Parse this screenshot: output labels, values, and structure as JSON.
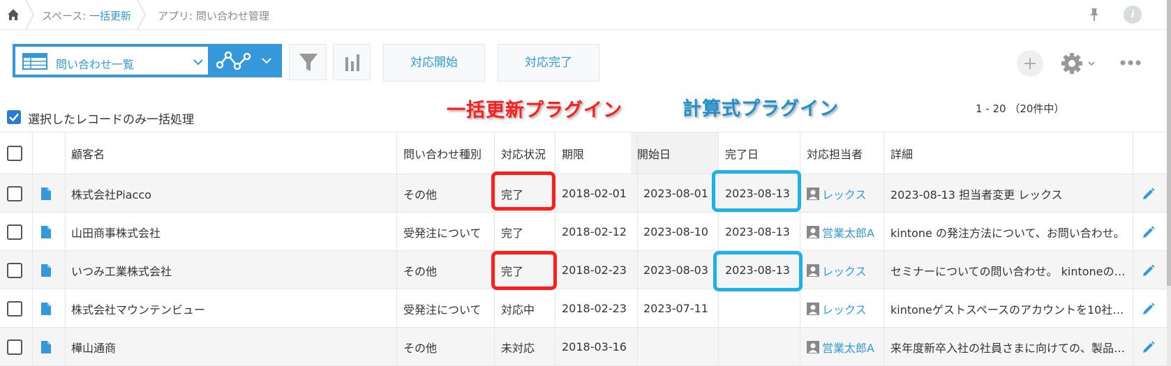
{
  "breadcrumb": {
    "space_prefix": "スペース: ",
    "space_name": "一括更新",
    "app_label": "アプリ: 問い合わせ管理"
  },
  "header_icons": {
    "home": "home-icon",
    "pin": "pin-icon",
    "info": "info-icon",
    "info_glyph": "i"
  },
  "toolbar": {
    "view_name": "問い合わせ一覧",
    "action_start": "対応開始",
    "action_complete": "対応完了",
    "icons": [
      "table-view-icon",
      "chevron-down-icon",
      "graph-icon",
      "filter-icon",
      "bar-chart-icon",
      "plus-icon",
      "gear-icon",
      "more-icon"
    ]
  },
  "bulk": {
    "checkbox_label": "選択したレコードのみ一括処理",
    "checked": true
  },
  "overlays": {
    "red_label": "一括更新プラグイン",
    "blue_label": "計算式プラグイン"
  },
  "pager": {
    "text": "1 - 20 （20件中）"
  },
  "table": {
    "columns": [
      "顧客名",
      "問い合わせ種別",
      "対応状況",
      "期限",
      "開始日",
      "完了日",
      "対応担当者",
      "詳細"
    ],
    "rows": [
      {
        "customer": "株式会社Piacco",
        "type": "その他",
        "status": "完了",
        "deadline": "2018-02-01",
        "start": "2023-08-01",
        "done": "2023-08-13",
        "assignee": "レックス",
        "detail": "2023-08-13 担当者変更 レックス"
      },
      {
        "customer": "山田商事株式会社",
        "type": "受発注について",
        "status": "完了",
        "deadline": "2018-02-12",
        "start": "2023-08-10",
        "done": "2023-08-13",
        "assignee": "営業太郎A",
        "detail": "kintone の発注方法について、お問い合わせ。"
      },
      {
        "customer": "いつみ工業株式会社",
        "type": "その他",
        "status": "完了",
        "deadline": "2018-02-23",
        "start": "2023-08-03",
        "done": "2023-08-13",
        "assignee": "レックス",
        "detail": "セミナーについての問い合わせ。 kintoneの…"
      },
      {
        "customer": "株式会社マウンテンビュー",
        "type": "受発注について",
        "status": "対応中",
        "deadline": "2018-02-23",
        "start": "2023-07-11",
        "done": "",
        "assignee": "レックス",
        "detail": "kintoneゲストスペースのアカウントを10社…"
      },
      {
        "customer": "樺山通商",
        "type": "その他",
        "status": "未対応",
        "deadline": "2018-03-16",
        "start": "",
        "done": "",
        "assignee": "営業太郎A",
        "detail": "来年度新卒入社の社員さまに向けての、製品…"
      }
    ]
  },
  "colors": {
    "accent": "#3498db",
    "red_highlight": "#ff1e1e",
    "blue_highlight": "#1eb0e8"
  }
}
